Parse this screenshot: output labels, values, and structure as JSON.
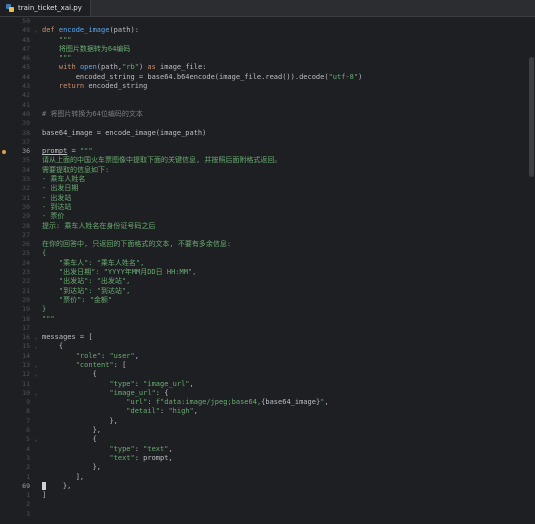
{
  "tab": {
    "filename": "train_ticket_xai.py"
  },
  "lines": [
    {
      "n": "50",
      "t": []
    },
    {
      "n": "49",
      "f": "⌄",
      "t": [
        [
          "kw",
          "def "
        ],
        [
          "fn",
          "encode_image"
        ],
        [
          "",
          "(path):"
        ]
      ]
    },
    {
      "n": "48",
      "t": [
        [
          "str",
          "    \"\"\""
        ]
      ]
    },
    {
      "n": "47",
      "t": [
        [
          "str",
          "    将图片数据转为64编码"
        ]
      ]
    },
    {
      "n": "46",
      "t": [
        [
          "str",
          "    \"\"\""
        ]
      ]
    },
    {
      "n": "45",
      "t": [
        [
          "kw",
          "    with "
        ],
        [
          "fn",
          "open"
        ],
        [
          "",
          "(path,"
        ],
        [
          "str",
          "\"rb\""
        ],
        [
          "",
          ") "
        ],
        [
          "kw",
          "as "
        ],
        [
          "",
          "image_file:"
        ]
      ]
    },
    {
      "n": "44",
      "t": [
        [
          "",
          "        encoded_string = base64.b64encode(image_file.read()).decode("
        ],
        [
          "str",
          "\"utf-8\""
        ],
        [
          "",
          ")"
        ]
      ]
    },
    {
      "n": "43",
      "t": [
        [
          "kw",
          "    return "
        ],
        [
          "",
          "encoded_string"
        ]
      ]
    },
    {
      "n": "42",
      "t": []
    },
    {
      "n": "41",
      "t": []
    },
    {
      "n": "40",
      "t": [
        [
          "cm",
          "# 将图片转换为64位编码的文本"
        ]
      ]
    },
    {
      "n": "39",
      "t": []
    },
    {
      "n": "38",
      "t": [
        [
          "",
          "base64_image = encode_image(image_path)"
        ]
      ]
    },
    {
      "n": "37",
      "t": []
    },
    {
      "n": "36",
      "dot": true,
      "cur": true,
      "t": [
        [
          "u",
          "prompt"
        ],
        [
          "",
          " = "
        ],
        [
          "str",
          "\"\"\""
        ]
      ]
    },
    {
      "n": "35",
      "t": [
        [
          "str",
          "请从上面的中国火车票图像中提取下面的关键信息, 并按照后面附格式返回。"
        ]
      ]
    },
    {
      "n": "34",
      "t": [
        [
          "str",
          "需要提取的信息如下:"
        ]
      ]
    },
    {
      "n": "33",
      "t": [
        [
          "str",
          "- 乘车人姓名"
        ]
      ]
    },
    {
      "n": "32",
      "t": [
        [
          "str",
          "- 出发日期"
        ]
      ]
    },
    {
      "n": "31",
      "t": [
        [
          "str",
          "- 出发站"
        ]
      ]
    },
    {
      "n": "30",
      "t": [
        [
          "str",
          "- 到达站"
        ]
      ]
    },
    {
      "n": "29",
      "t": [
        [
          "str",
          "- 票价"
        ]
      ]
    },
    {
      "n": "28",
      "t": [
        [
          "str",
          "提示: 乘车人姓名在身份证号码之后"
        ]
      ]
    },
    {
      "n": "27",
      "t": []
    },
    {
      "n": "26",
      "t": [
        [
          "str",
          "在你的回答中, 只返回的下面格式的文本, 不要有多余信息:"
        ]
      ]
    },
    {
      "n": "25",
      "t": [
        [
          "str",
          "{"
        ]
      ]
    },
    {
      "n": "24",
      "t": [
        [
          "str",
          "    \"乘车人\": \"乘车人姓名\","
        ]
      ]
    },
    {
      "n": "23",
      "t": [
        [
          "str",
          "    \"出发日期\": \"YYYY年MM月DD日 HH:MM\","
        ]
      ]
    },
    {
      "n": "22",
      "t": [
        [
          "str",
          "    \"出发站\": \"出发站\","
        ]
      ]
    },
    {
      "n": "21",
      "t": [
        [
          "str",
          "    \"到达站\": \"到达站\","
        ]
      ]
    },
    {
      "n": "20",
      "t": [
        [
          "str",
          "    \"票价\": \"金额\""
        ]
      ]
    },
    {
      "n": "19",
      "t": [
        [
          "str",
          "}"
        ]
      ]
    },
    {
      "n": "18",
      "t": [
        [
          "str",
          "\"\"\""
        ]
      ]
    },
    {
      "n": "17",
      "t": []
    },
    {
      "n": "16",
      "f": "⌄",
      "t": [
        [
          "",
          "messages = ["
        ]
      ]
    },
    {
      "n": "15",
      "f": "⌄",
      "t": [
        [
          "",
          "    {"
        ]
      ]
    },
    {
      "n": "14",
      "t": [
        [
          "str",
          "        \"role\""
        ],
        [
          "",
          ": "
        ],
        [
          "str",
          "\"user\""
        ],
        [
          "",
          ","
        ]
      ]
    },
    {
      "n": "13",
      "f": "⌄",
      "t": [
        [
          "str",
          "        \"content\""
        ],
        [
          "",
          ": ["
        ]
      ]
    },
    {
      "n": "12",
      "f": "⌄",
      "t": [
        [
          "",
          "            {"
        ]
      ]
    },
    {
      "n": "11",
      "t": [
        [
          "str",
          "                \"type\""
        ],
        [
          "",
          ": "
        ],
        [
          "str",
          "\"image_url\""
        ],
        [
          "",
          ","
        ]
      ]
    },
    {
      "n": "10",
      "f": "⌄",
      "t": [
        [
          "str",
          "                \"image_url\""
        ],
        [
          "",
          ": {"
        ]
      ]
    },
    {
      "n": "9",
      "t": [
        [
          "str",
          "                    \"url\""
        ],
        [
          "",
          ": "
        ],
        [
          "str",
          "f\"data:image/jpeg;base64,"
        ],
        [
          "",
          "{base64_image}"
        ],
        [
          "str",
          "\""
        ],
        [
          "",
          ","
        ]
      ]
    },
    {
      "n": "8",
      "t": [
        [
          "str",
          "                    \"detail\""
        ],
        [
          "",
          ": "
        ],
        [
          "str",
          "\"high\""
        ],
        [
          "",
          ","
        ]
      ]
    },
    {
      "n": "7",
      "t": [
        [
          "",
          "                },"
        ]
      ]
    },
    {
      "n": "6",
      "t": [
        [
          "",
          "            },"
        ]
      ]
    },
    {
      "n": "5",
      "f": "⌄",
      "t": [
        [
          "",
          "            {"
        ]
      ]
    },
    {
      "n": "4",
      "t": [
        [
          "str",
          "                \"type\""
        ],
        [
          "",
          ": "
        ],
        [
          "str",
          "\"text\""
        ],
        [
          "",
          ","
        ]
      ]
    },
    {
      "n": "3",
      "t": [
        [
          "str",
          "                \"text\""
        ],
        [
          "",
          ": prompt,"
        ]
      ]
    },
    {
      "n": "2",
      "t": [
        [
          "",
          "            },"
        ]
      ]
    },
    {
      "n": "1",
      "t": [
        [
          "",
          "        ],"
        ]
      ]
    },
    {
      "n": "69",
      "cur": true,
      "caret": true,
      "t": [
        [
          "",
          "    },"
        ]
      ]
    },
    {
      "n": "1",
      "t": [
        [
          "",
          "]"
        ]
      ]
    },
    {
      "n": "2",
      "t": []
    },
    {
      "n": "3",
      "t": []
    }
  ]
}
